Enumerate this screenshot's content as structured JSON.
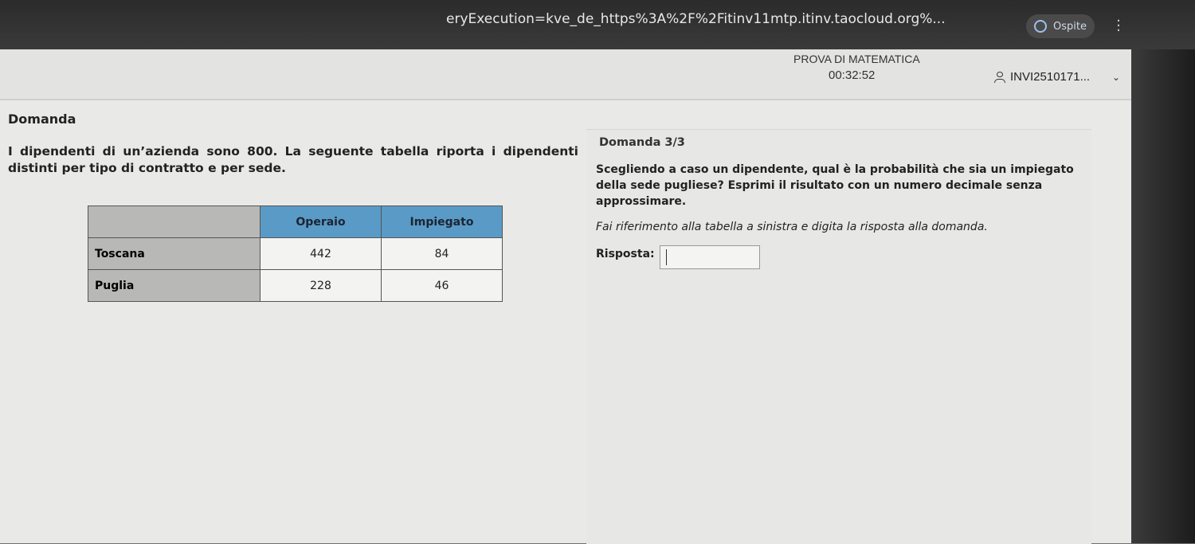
{
  "browser": {
    "url": "eryExecution=kve_de_https%3A%2F%2Fitinv11mtp.itinv.taocloud.org%...",
    "profile_label": "Ospite",
    "profile_icon": "user-circle-icon",
    "menu_icon": "kebab-menu-icon"
  },
  "header": {
    "exam_title": "PROVA DI MATEMATICA",
    "timer": "00:32:52",
    "user_id": "INVI2510171...",
    "user_icon": "user-icon",
    "dropdown_icon": "chevron-down-icon"
  },
  "left": {
    "section_label": "Domanda",
    "stem": "I dipendenti di un’azienda sono 800. La seguente tabella riporta i dipendenti distinti per tipo di contratto e per sede.",
    "table": {
      "headers": [
        "",
        "Operaio",
        "Impiegato"
      ],
      "rows": [
        {
          "label": "Toscana",
          "operaio": "442",
          "impiegato": "84"
        },
        {
          "label": "Puglia",
          "operaio": "228",
          "impiegato": "46"
        }
      ]
    }
  },
  "right": {
    "question_number": "Domanda 3/3",
    "question_text": "Scegliendo a caso un dipendente, qual è la probabilità che sia un impiegato della sede pugliese? Esprimi il risultato con un numero decimale senza approssimare.",
    "hint": "Fai riferimento alla tabella a sinistra e digita la risposta alla domanda.",
    "answer_label": "Risposta:",
    "answer_value": ""
  }
}
